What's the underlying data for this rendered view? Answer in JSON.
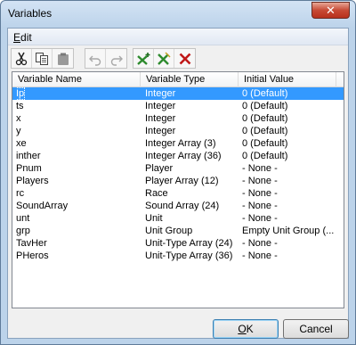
{
  "window": {
    "title": "Variables",
    "close_glyph": "✕"
  },
  "menu": {
    "edit_first": "E",
    "edit_rest": "dit"
  },
  "toolbar": {
    "buttons": [
      {
        "name": "cut-icon",
        "enabled": true
      },
      {
        "name": "copy-icon",
        "enabled": true
      },
      {
        "name": "paste-icon",
        "enabled": false
      },
      {
        "name": "undo-icon",
        "enabled": false
      },
      {
        "name": "redo-icon",
        "enabled": false
      },
      {
        "name": "new-variable-icon",
        "enabled": true
      },
      {
        "name": "edit-variable-icon",
        "enabled": true
      },
      {
        "name": "delete-variable-icon",
        "enabled": true
      }
    ]
  },
  "columns": [
    "Variable Name",
    "Variable Type",
    "Initial Value"
  ],
  "rows": [
    [
      "Ip",
      "Integer",
      "0 (Default)"
    ],
    [
      "ts",
      "Integer",
      "0 (Default)"
    ],
    [
      "x",
      "Integer",
      "0 (Default)"
    ],
    [
      "y",
      "Integer",
      "0 (Default)"
    ],
    [
      "xe",
      "Integer Array (3)",
      "0 (Default)"
    ],
    [
      "inther",
      "Integer Array (36)",
      "0 (Default)"
    ],
    [
      "Pnum",
      "Player",
      "- None -"
    ],
    [
      "Players",
      "Player Array (12)",
      "- None -"
    ],
    [
      "rc",
      "Race",
      "- None -"
    ],
    [
      "SoundArray",
      "Sound Array (24)",
      "- None -"
    ],
    [
      "unt",
      "Unit",
      "- None -"
    ],
    [
      "grp",
      "Unit Group",
      "Empty Unit Group (..."
    ],
    [
      "TavHer",
      "Unit-Type Array (24)",
      "- None -"
    ],
    [
      "PHeros",
      "Unit-Type Array (36)",
      "- None -"
    ]
  ],
  "selected_row": 0,
  "buttons": {
    "ok_first": "O",
    "ok_rest": "K",
    "cancel": "Cancel"
  },
  "colors": {
    "selection": "#3399ff",
    "accept_green": "#2e8b2e",
    "delete_red": "#c01818"
  }
}
